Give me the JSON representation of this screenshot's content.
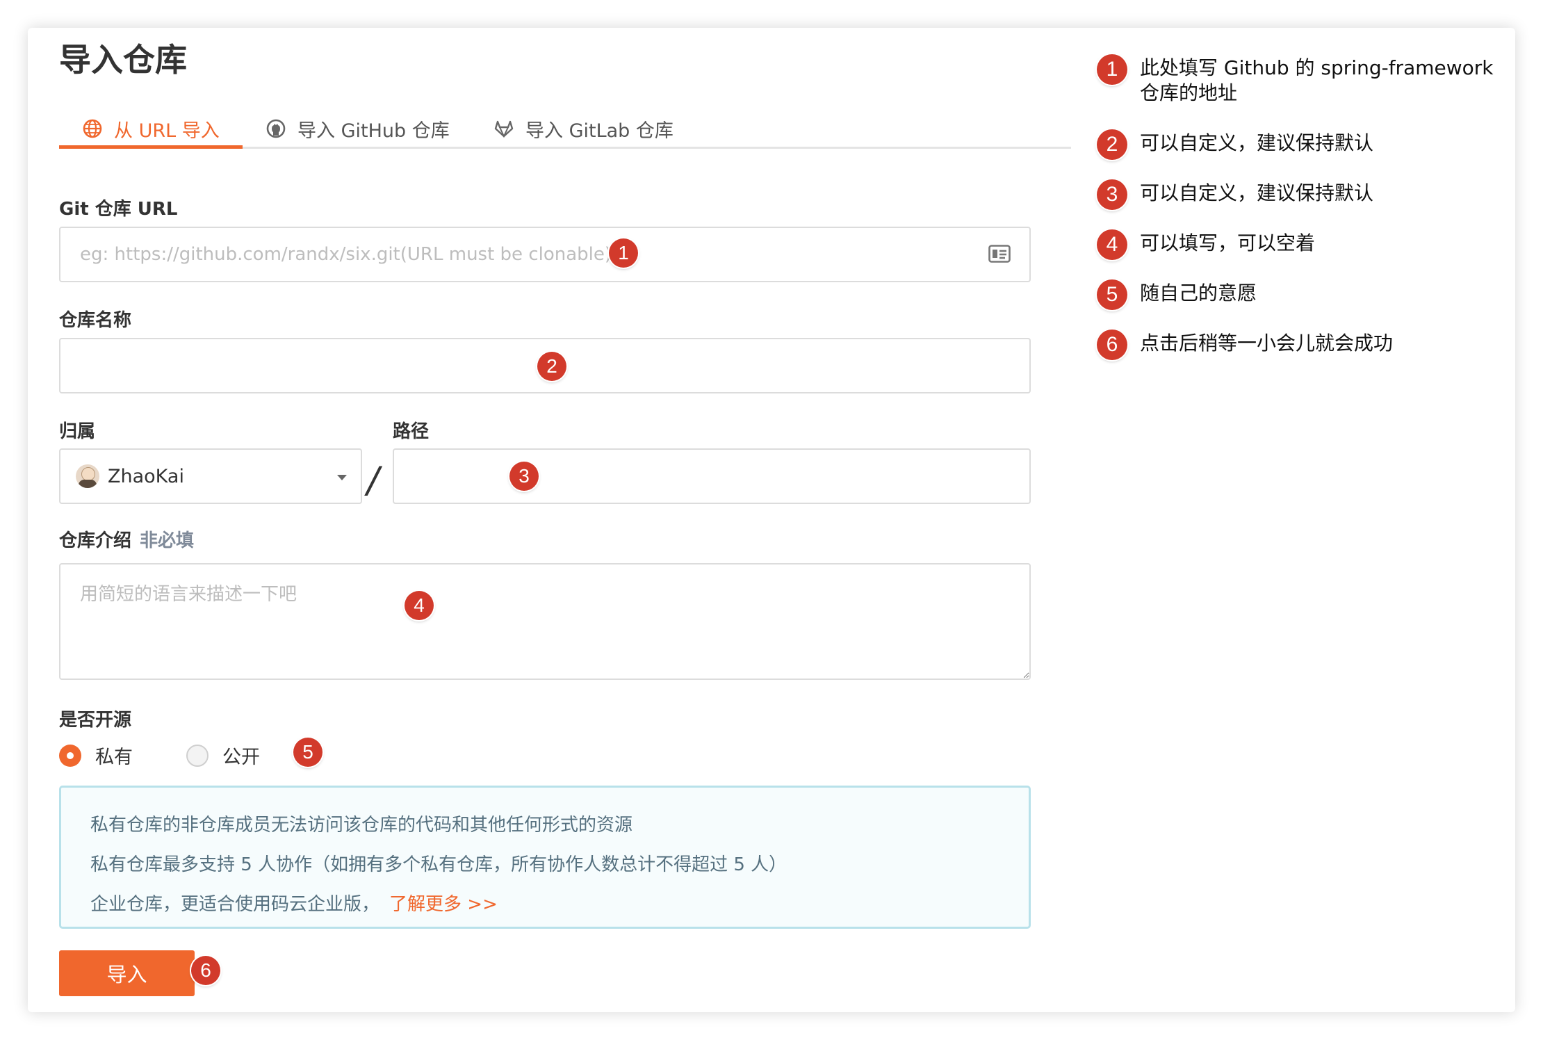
{
  "page": {
    "title": "导入仓库"
  },
  "tabs": [
    {
      "label": "从 URL 导入",
      "icon": "globe-icon",
      "active": true
    },
    {
      "label": "导入 GitHub 仓库",
      "icon": "github-icon",
      "active": false
    },
    {
      "label": "导入 GitLab 仓库",
      "icon": "gitlab-icon",
      "active": false
    }
  ],
  "form": {
    "git_url": {
      "label": "Git 仓库 URL",
      "value": "",
      "placeholder": "eg: https://github.com/randx/six.git(URL must be clonable)"
    },
    "repo_name": {
      "label": "仓库名称",
      "value": ""
    },
    "owner": {
      "label": "归属",
      "selected": "ZhaoKai"
    },
    "path_separator": "/",
    "path": {
      "label": "路径",
      "value": ""
    },
    "description": {
      "label": "仓库介绍",
      "optional_note": "非必填",
      "value": "",
      "placeholder": "用简短的语言来描述一下吧"
    },
    "visibility": {
      "label": "是否开源",
      "options": [
        {
          "label": "私有",
          "checked": true
        },
        {
          "label": "公开",
          "checked": false
        }
      ]
    },
    "info": {
      "lines": [
        "私有仓库的非仓库成员无法访问该仓库的代码和其他任何形式的资源",
        "私有仓库最多支持 5 人协作（如拥有多个私有仓库，所有协作人数总计不得超过 5 人）",
        "企业仓库，更适合使用码云企业版，"
      ],
      "link_label": "了解更多 >>"
    },
    "submit_label": "导入"
  },
  "markers": [
    "1",
    "2",
    "3",
    "4",
    "5",
    "6"
  ],
  "notes": [
    {
      "number": "1",
      "text": "此处填写 Github 的 spring-framework 仓库的地址"
    },
    {
      "number": "2",
      "text": "可以自定义，建议保持默认"
    },
    {
      "number": "3",
      "text": "可以自定义，建议保持默认"
    },
    {
      "number": "4",
      "text": "可以填写，可以空着"
    },
    {
      "number": "5",
      "text": "随自己的意愿"
    },
    {
      "number": "6",
      "text": "点击后稍等一小会儿就会成功"
    }
  ],
  "colors": {
    "accent": "#f0672d",
    "marker": "#d23a2b",
    "info_bg": "#f6fcfd",
    "info_border": "#b8e1ea"
  }
}
